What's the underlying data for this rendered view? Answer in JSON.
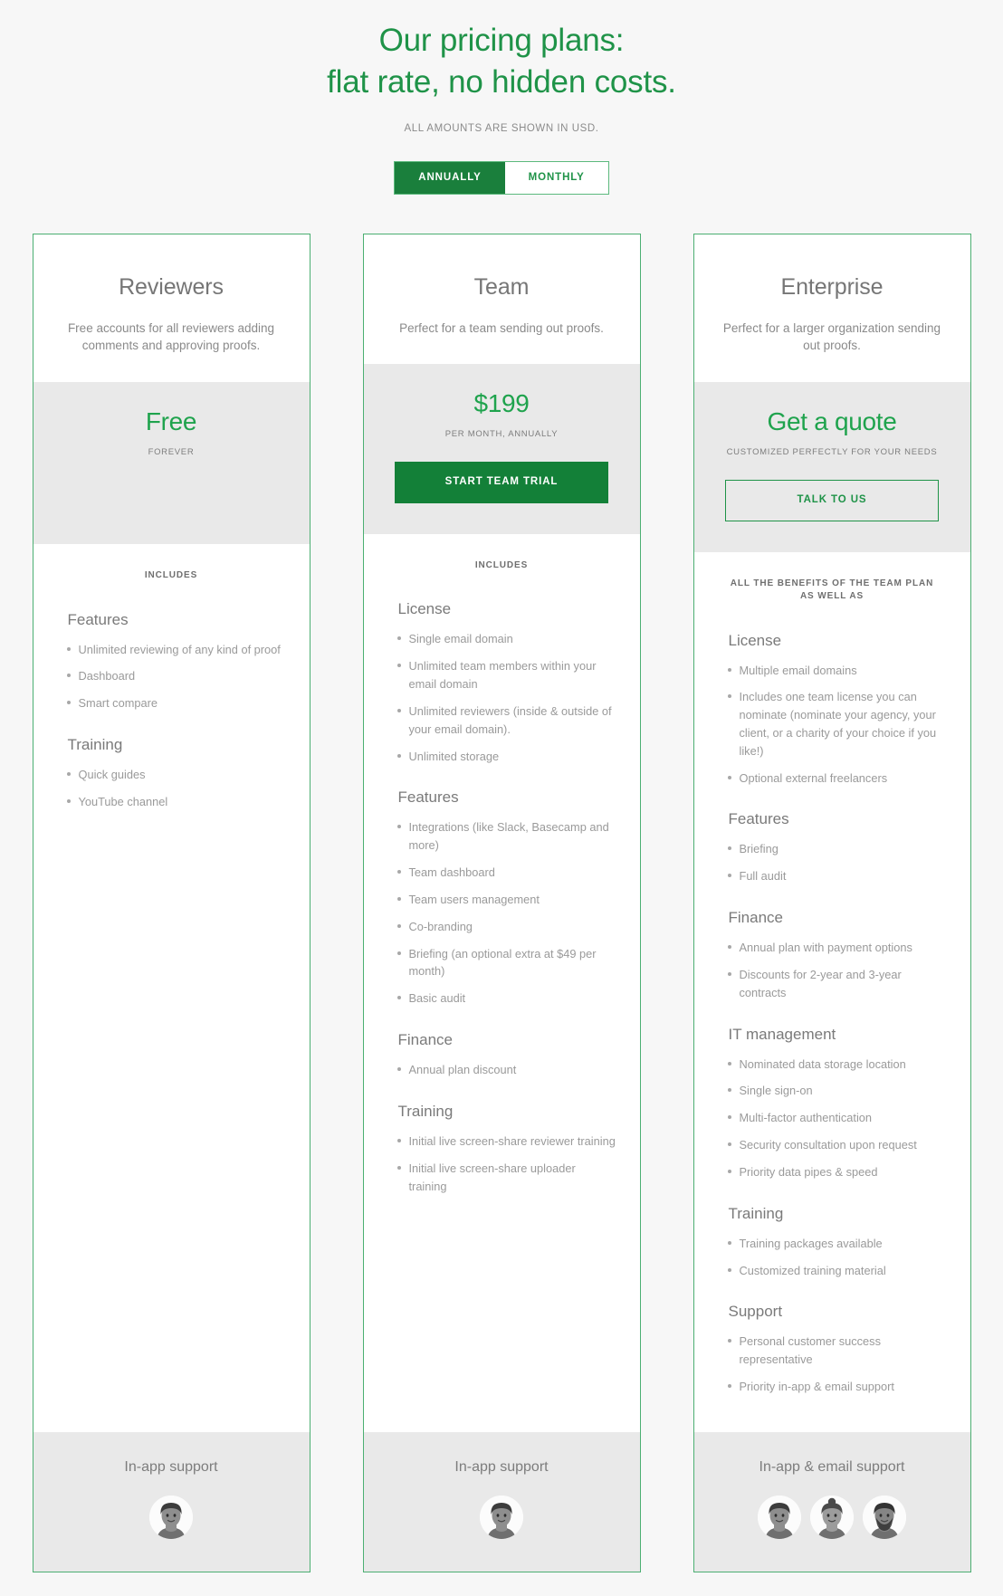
{
  "hero": {
    "title_line1": "Our pricing plans:",
    "title_line2": "flat rate, no hidden costs.",
    "subtitle": "ALL AMOUNTS ARE SHOWN IN USD.",
    "accent_color": "#1f9348"
  },
  "billing_toggle": {
    "options": [
      "ANNUALLY",
      "MONTHLY"
    ],
    "selected": "ANNUALLY",
    "annually_label": "ANNUALLY",
    "monthly_label": "MONTHLY",
    "active_bg": "#1a7f3c",
    "border_color": "#5cb97d"
  },
  "plans": [
    {
      "name": "Reviewers",
      "description": "Free accounts for all reviewers adding comments and approving proofs.",
      "price": "Free",
      "price_note": "FOREVER",
      "cta": null,
      "includes_label": "INCLUDES",
      "groups": [
        {
          "title": "Features",
          "items": [
            "Unlimited reviewing of any kind of proof",
            "Dashboard",
            "Smart compare"
          ]
        },
        {
          "title": "Training",
          "items": [
            "Quick guides",
            "YouTube channel"
          ]
        }
      ],
      "support_label": "In-app support",
      "avatar_count": 1
    },
    {
      "name": "Team",
      "description": "Perfect for a team sending out proofs.",
      "price": "$199",
      "price_note": "PER MONTH, ANNUALLY",
      "cta": {
        "label": "START TEAM TRIAL",
        "style": "solid"
      },
      "includes_label": "INCLUDES",
      "groups": [
        {
          "title": "License",
          "items": [
            "Single email domain",
            "Unlimited team members within your email domain",
            "Unlimited reviewers (inside & outside of your email domain).",
            "Unlimited storage"
          ]
        },
        {
          "title": "Features",
          "items": [
            "Integrations (like Slack, Basecamp and more)",
            "Team dashboard",
            "Team users management",
            "Co-branding",
            "Briefing (an optional extra at $49 per month)",
            "Basic audit"
          ]
        },
        {
          "title": "Finance",
          "items": [
            "Annual plan discount"
          ]
        },
        {
          "title": "Training",
          "items": [
            "Initial live screen-share reviewer training",
            "Initial live screen-share uploader training"
          ]
        }
      ],
      "support_label": "In-app support",
      "avatar_count": 1
    },
    {
      "name": "Enterprise",
      "description": "Perfect for a larger organization sending out proofs.",
      "price": "Get a quote",
      "price_note": "CUSTOMIZED PERFECTLY FOR YOUR NEEDS",
      "cta": {
        "label": "TALK TO US",
        "style": "ghost"
      },
      "includes_label": "ALL THE BENEFITS OF THE TEAM PLAN AS WELL AS",
      "groups": [
        {
          "title": "License",
          "items": [
            "Multiple email domains",
            "Includes one team license you can nominate (nominate your agency, your client, or a charity of your choice if you like!)",
            "Optional external freelancers"
          ]
        },
        {
          "title": "Features",
          "items": [
            "Briefing",
            "Full audit"
          ]
        },
        {
          "title": "Finance",
          "items": [
            "Annual plan with payment options",
            "Discounts for 2-year and 3-year contracts"
          ]
        },
        {
          "title": "IT management",
          "items": [
            "Nominated data storage location",
            "Single sign-on",
            "Multi-factor authentication",
            "Security consultation upon request",
            "Priority data pipes & speed"
          ]
        },
        {
          "title": "Training",
          "items": [
            "Training packages available",
            "Customized training material"
          ]
        },
        {
          "title": "Support",
          "items": [
            "Personal customer success representative",
            "Priority in-app & email support"
          ]
        }
      ],
      "support_label": "In-app & email support",
      "avatar_count": 3
    }
  ]
}
